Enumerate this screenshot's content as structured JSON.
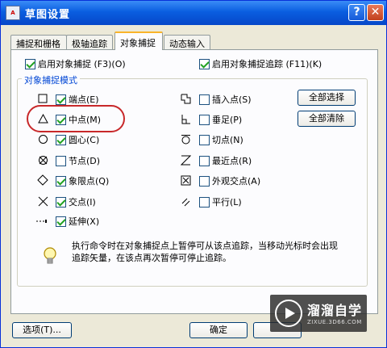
{
  "window": {
    "title": "草图设置",
    "app_icon_text": "A",
    "help_glyph": "?",
    "close_glyph": "✕"
  },
  "tabs": [
    {
      "label": "捕捉和栅格",
      "active": false
    },
    {
      "label": "极轴追踪",
      "active": false
    },
    {
      "label": "对象捕捉",
      "active": true
    },
    {
      "label": "动态输入",
      "active": false
    }
  ],
  "top_checks": {
    "enable_osnap": {
      "label": "启用对象捕捉 (F3)(O)",
      "checked": true
    },
    "enable_tracking": {
      "label": "启用对象捕捉追踪 (F11)(K)",
      "checked": true
    }
  },
  "group": {
    "title": "对象捕捉模式",
    "left_items": [
      {
        "label": "端点(E)",
        "checked": true,
        "icon": "square-icon"
      },
      {
        "label": "中点(M)",
        "checked": true,
        "icon": "triangle-icon"
      },
      {
        "label": "圆心(C)",
        "checked": true,
        "icon": "circle-icon"
      },
      {
        "label": "节点(D)",
        "checked": false,
        "icon": "node-icon"
      },
      {
        "label": "象限点(Q)",
        "checked": true,
        "icon": "diamond-icon"
      },
      {
        "label": "交点(I)",
        "checked": true,
        "icon": "cross-icon"
      },
      {
        "label": "延伸(X)",
        "checked": true,
        "icon": "extension-icon"
      }
    ],
    "right_items": [
      {
        "label": "插入点(S)",
        "checked": false,
        "icon": "insertion-icon"
      },
      {
        "label": "垂足(P)",
        "checked": false,
        "icon": "perpendicular-icon"
      },
      {
        "label": "切点(N)",
        "checked": false,
        "icon": "tangent-icon"
      },
      {
        "label": "最近点(R)",
        "checked": false,
        "icon": "nearest-icon"
      },
      {
        "label": "外观交点(A)",
        "checked": false,
        "icon": "apparent-intersection-icon"
      },
      {
        "label": "平行(L)",
        "checked": false,
        "icon": "parallel-icon"
      }
    ],
    "select_all_label": "全部选择",
    "clear_all_label": "全部清除"
  },
  "tip_text": "执行命令时在对象捕捉点上暂停可从该点追踪，当移动光标时会出现追踪矢量，在该点再次暂停可停止追踪。",
  "footer": {
    "options_label": "选项(T)...",
    "ok_label": "确定"
  },
  "watermark": {
    "name": "溜溜自学",
    "url": "ZIXUE.3D66.COM"
  },
  "colors": {
    "accent": "#0046d5",
    "check": "#21a121",
    "highlight": "#c8282a"
  }
}
